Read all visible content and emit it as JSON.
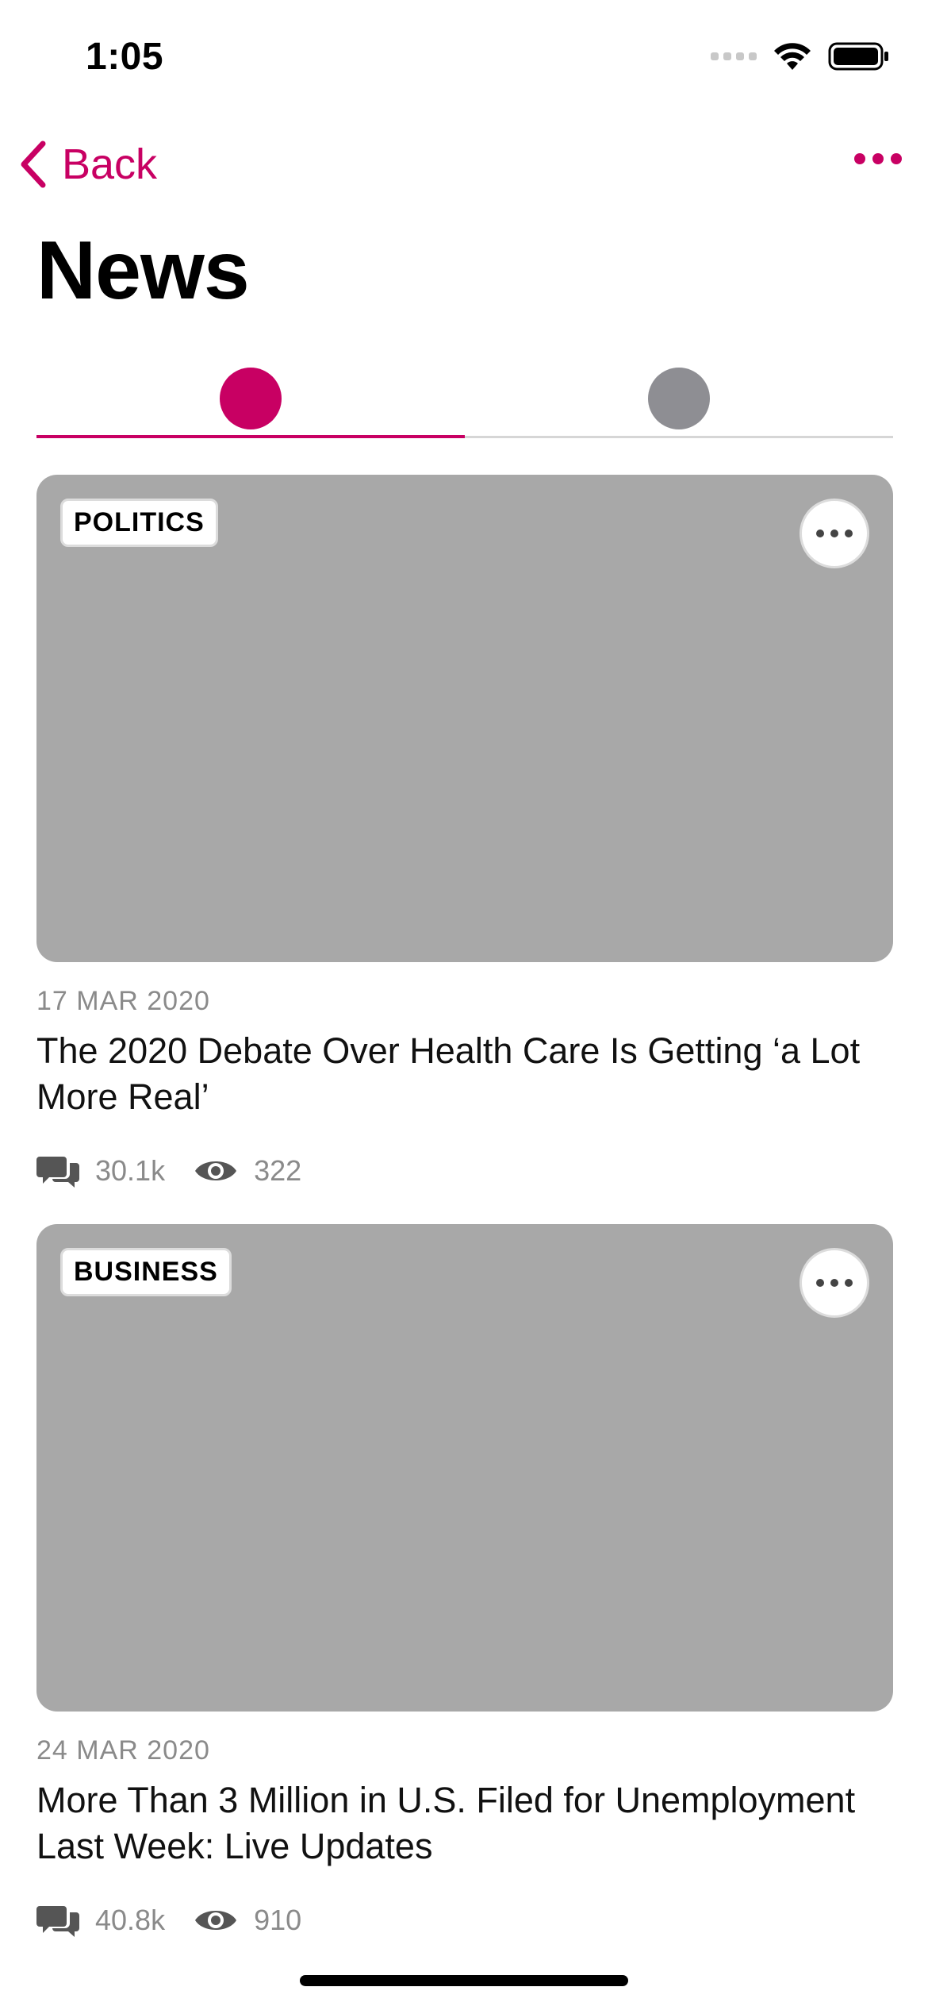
{
  "status_bar": {
    "time": "1:05"
  },
  "nav": {
    "back_label": "Back"
  },
  "page_title": "News",
  "colors": {
    "accent": "#c80063",
    "inactive": "#8e8e93",
    "image_placeholder": "#a8a8a8"
  },
  "tabs": [
    {
      "active": true,
      "color": "#c80063"
    },
    {
      "active": false,
      "color": "#8e8e93"
    }
  ],
  "articles": [
    {
      "tag": "POLITICS",
      "date": "17 MAR 2020",
      "title": "The 2020 Debate Over Health Care Is Getting ‘a Lot More Real’",
      "comments": "30.1k",
      "views": "322"
    },
    {
      "tag": "BUSINESS",
      "date": "24 MAR 2020",
      "title": "More Than 3 Million in U.S. Filed for Unemployment Last Week: Live Updates",
      "comments": "40.8k",
      "views": "910"
    }
  ]
}
